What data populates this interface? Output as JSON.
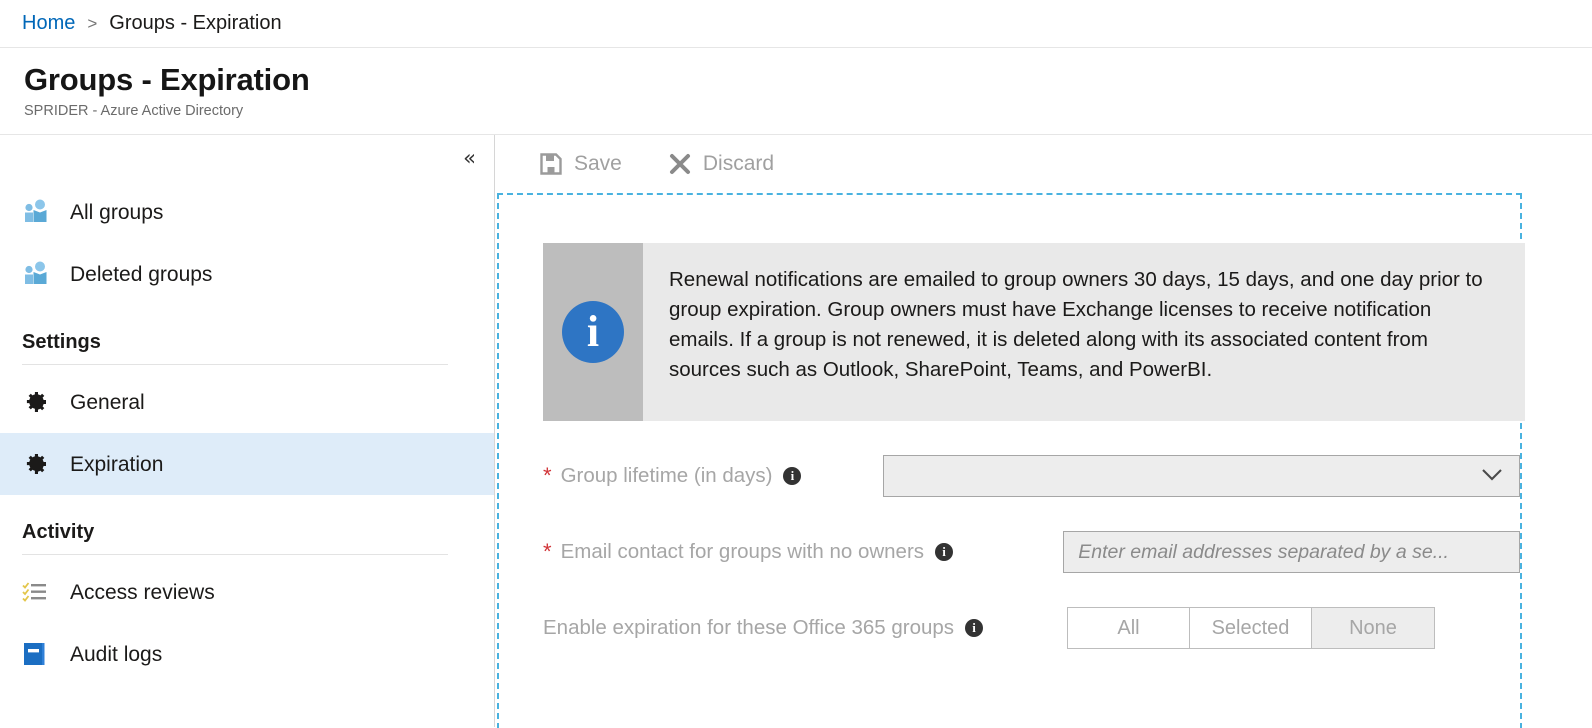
{
  "breadcrumb": {
    "home": "Home",
    "separator": ">",
    "current": "Groups - Expiration"
  },
  "header": {
    "title": "Groups - Expiration",
    "subtitle": "SPRIDER - Azure Active Directory"
  },
  "sidebar": {
    "collapse_icon": "«",
    "items": [
      {
        "label": "All groups",
        "icon": "groups-icon"
      },
      {
        "label": "Deleted groups",
        "icon": "groups-icon"
      }
    ],
    "settings_section": {
      "heading": "Settings",
      "items": [
        {
          "label": "General",
          "icon": "gear-icon"
        },
        {
          "label": "Expiration",
          "icon": "gear-icon"
        }
      ]
    },
    "activity_section": {
      "heading": "Activity",
      "items": [
        {
          "label": "Access reviews",
          "icon": "checklist-icon"
        },
        {
          "label": "Audit logs",
          "icon": "book-icon"
        }
      ]
    }
  },
  "toolbar": {
    "save_label": "Save",
    "discard_label": "Discard"
  },
  "banner": {
    "icon": "info-icon",
    "text": "Renewal notifications are emailed to group owners 30 days, 15 days, and one day prior to group expiration. Group owners must have Exchange licenses to receive notification emails. If a group is not renewed, it is deleted along with its associated content from sources such as Outlook, SharePoint, Teams, and PowerBI."
  },
  "form": {
    "group_lifetime": {
      "required_marker": "*",
      "label": "Group lifetime (in days)",
      "info_glyph": "i",
      "value": "",
      "chevron": "⌄"
    },
    "email_contact": {
      "required_marker": "*",
      "label": "Email contact for groups with no owners",
      "info_glyph": "i",
      "value": "",
      "placeholder": "Enter email addresses separated by a se..."
    },
    "enable_expiration": {
      "label": "Enable expiration for these Office 365 groups",
      "info_glyph": "i",
      "options": [
        "All",
        "Selected",
        "None"
      ],
      "selected": "None"
    }
  },
  "colors": {
    "accent_link": "#0067b8",
    "selection_highlight": "#deecf9",
    "dashed_border": "#49b2df",
    "required_star": "#d13438",
    "info_blue": "#2e75c4"
  }
}
